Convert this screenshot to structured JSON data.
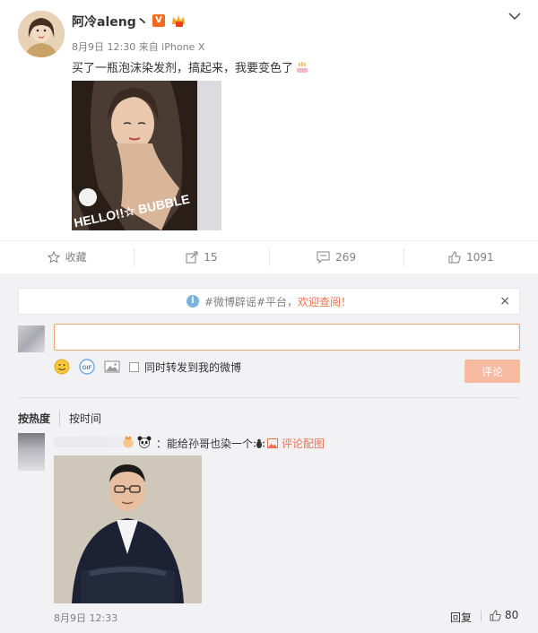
{
  "post": {
    "username": "阿冷aleng丶",
    "verified_badge": "V",
    "meta": "8月9日 12:30 来自 iPhone X",
    "text": "买了一瓶泡沫染发剂，搞起来，我要变色了",
    "image_label": "HELLO!!☆ BUBBLE"
  },
  "actions": {
    "favorite": "收藏",
    "repost_count": "15",
    "comment_count": "269",
    "like_count": "1091"
  },
  "notice": {
    "prefix": "#微博辟谣#平台，",
    "link": "欢迎查阅！",
    "close": "×"
  },
  "composer": {
    "placeholder": "",
    "sync_label": "同时转发到我的微博",
    "submit_label": "评论"
  },
  "sort": {
    "by_hot": "按热度",
    "by_time": "按时间"
  },
  "comments": [
    {
      "text": "：能给孙哥也染一个",
      "image_link": "评论配图",
      "time": "8月9日 12:33",
      "reply": "回复",
      "likes": "80"
    }
  ],
  "colors": {
    "accent": "#eb7350",
    "submit_disabled": "#f7b9a0",
    "comment_bg": "#f2f2f5",
    "input_border": "#f5a06d"
  },
  "icons": [
    "chevron-down-icon",
    "star-icon",
    "repost-icon",
    "comment-icon",
    "thumb-up-icon",
    "info-icon",
    "close-icon",
    "emoji-icon",
    "gif-icon",
    "picture-icon"
  ]
}
